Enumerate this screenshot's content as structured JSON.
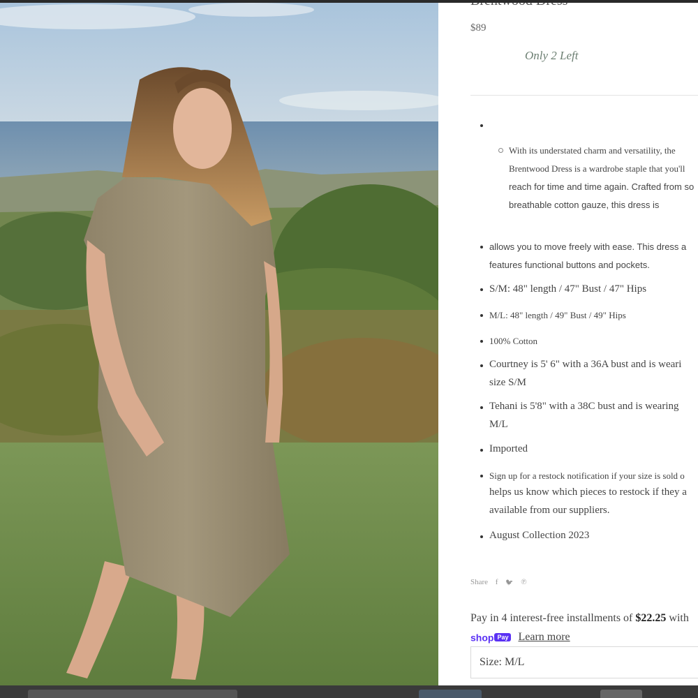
{
  "product": {
    "title": "Brentwood Dress",
    "price": "$89",
    "stock_note": "Only 2 Left"
  },
  "description": {
    "nested_text": [
      "With its understated charm and versatility, the",
      "Brentwood Dress is a wardrobe staple that you'll",
      "reach for time and time again. Crafted from so",
      "breathable cotton gauze, this dress is"
    ],
    "allows": [
      "allows you to move freely with ease. This dress a",
      "features functional buttons and pockets."
    ],
    "sm": "S/M: 48\" length / 47\" Bust / 47\" Hips",
    "ml": "M/L: 48\" length / 49\" Bust / 49\" Hips",
    "material": "100% Cotton",
    "courtney": [
      "Courtney is 5' 6\" with a 36A bust and is weari",
      "size S/M"
    ],
    "tehani": [
      "Tehani is 5'8\" with a 38C bust and is wearing",
      "M/L"
    ],
    "imported": "Imported",
    "restock": [
      "Sign up for a restock notification if your size is sold o",
      "helps us know which pieces to restock if they a",
      "available from our suppliers."
    ],
    "collection": "August Collection 2023"
  },
  "share": {
    "label": "Share",
    "facebook_icon": "f",
    "twitter_icon": "🐦",
    "pinterest_icon": "℗"
  },
  "payment": {
    "prefix": "Pay in 4 interest-free installments of",
    "amount": "$22.25",
    "suffix": "with",
    "shop_logo": "shop",
    "pay_badge": "Pay",
    "learn_more": "Learn more"
  },
  "size_selector": {
    "value": "Size: M/L"
  },
  "colors": {
    "shop_pay": "#5a31f4",
    "stock_text": "#6c7f72"
  }
}
